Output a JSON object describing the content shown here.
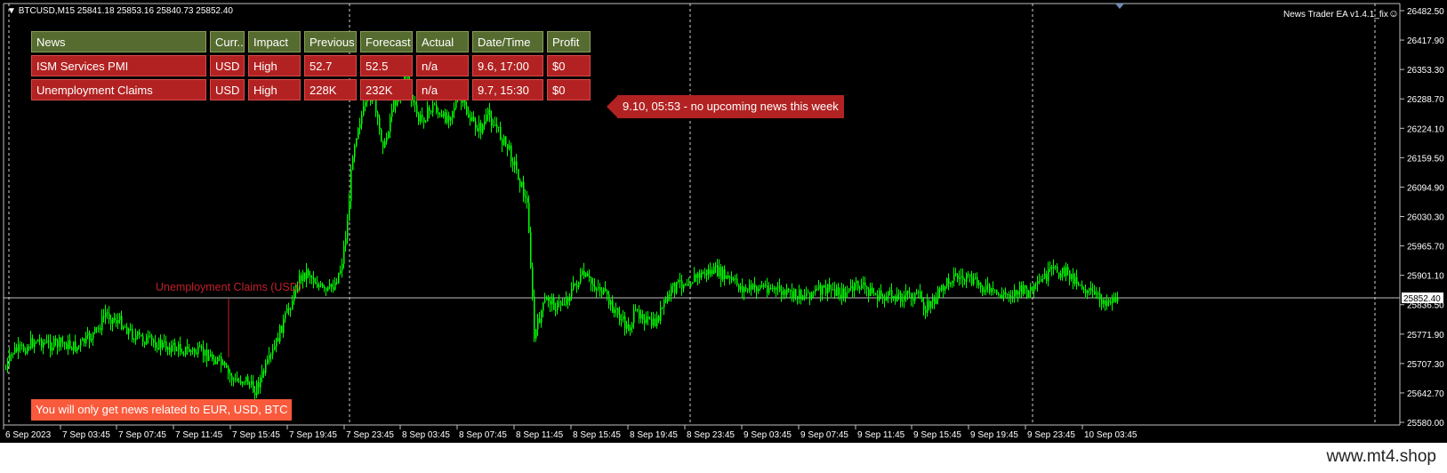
{
  "symbol_header": {
    "arrow": "▼",
    "text": "BTCUSD,M15  25841.18 25853.16 25840.73 25852.40"
  },
  "ea_label": "News Trader EA  v1.4.1_fix",
  "smiley_icon": "☺",
  "news_table": {
    "headers": [
      "News",
      "Curr..",
      "Impact",
      "Previous",
      "Forecast",
      "Actual",
      "Date/Time",
      "Profit"
    ],
    "rows": [
      [
        "ISM Services PMI",
        "USD",
        "High",
        "52.7",
        "52.5",
        "n/a",
        "9.6, 17:00",
        "$0"
      ],
      [
        "Unemployment Claims",
        "USD",
        "High",
        "228K",
        "232K",
        "n/a",
        "9.7, 15:30",
        "$0"
      ]
    ]
  },
  "tooltip": "9.10, 05:53 - no upcoming news this week",
  "notice": "You will only get news related to EUR, USD, BTC",
  "event_label": "Unemployment Claims (USD)",
  "price_axis": {
    "labels": [
      "26482.50",
      "26417.90",
      "26353.30",
      "26288.70",
      "26224.10",
      "26159.50",
      "26094.90",
      "26030.30",
      "25965.70",
      "25901.10",
      "25836.50",
      "25771.90",
      "25707.30",
      "25642.70",
      "25580.00"
    ],
    "current_price": "25852.40"
  },
  "time_axis": {
    "labels": [
      "6 Sep 2023",
      "7 Sep 03:45",
      "7 Sep 07:45",
      "7 Sep 11:45",
      "7 Sep 15:45",
      "7 Sep 19:45",
      "7 Sep 23:45",
      "8 Sep 03:45",
      "8 Sep 07:45",
      "8 Sep 11:45",
      "8 Sep 15:45",
      "8 Sep 19:45",
      "8 Sep 23:45",
      "9 Sep 03:45",
      "9 Sep 07:45",
      "9 Sep 11:45",
      "9 Sep 15:45",
      "9 Sep 19:45",
      "9 Sep 23:45",
      "10 Sep 03:45"
    ]
  },
  "watermark": "www.mt4.shop",
  "colors": {
    "candles": "#00ff00",
    "header_bg": "#556b2f",
    "row_bg": "#b22222",
    "notice_bg": "#fa5a3c",
    "grid": "#c0c0c0"
  }
}
